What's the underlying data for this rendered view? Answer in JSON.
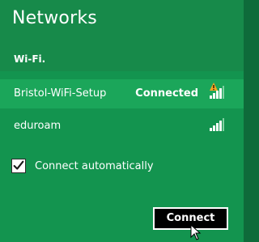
{
  "header": {
    "title": "Networks"
  },
  "section": {
    "label": "Wi-Fi."
  },
  "networks": [
    {
      "name": "Bristol-WiFi-Setup",
      "status": "Connected",
      "signal_bars": 4,
      "secured_warning": true
    },
    {
      "name": "eduroam",
      "status": "",
      "signal_bars": 4,
      "secured_warning": false
    }
  ],
  "connect_auto": {
    "label": "Connect automatically",
    "checked": true
  },
  "actions": {
    "connect_label": "Connect"
  },
  "colors": {
    "background": "#13944f",
    "header_background": "#178a4a",
    "selected_row": "#1ba65a",
    "warning": "#f5a623",
    "button_background": "#000000",
    "text": "#ffffff"
  }
}
